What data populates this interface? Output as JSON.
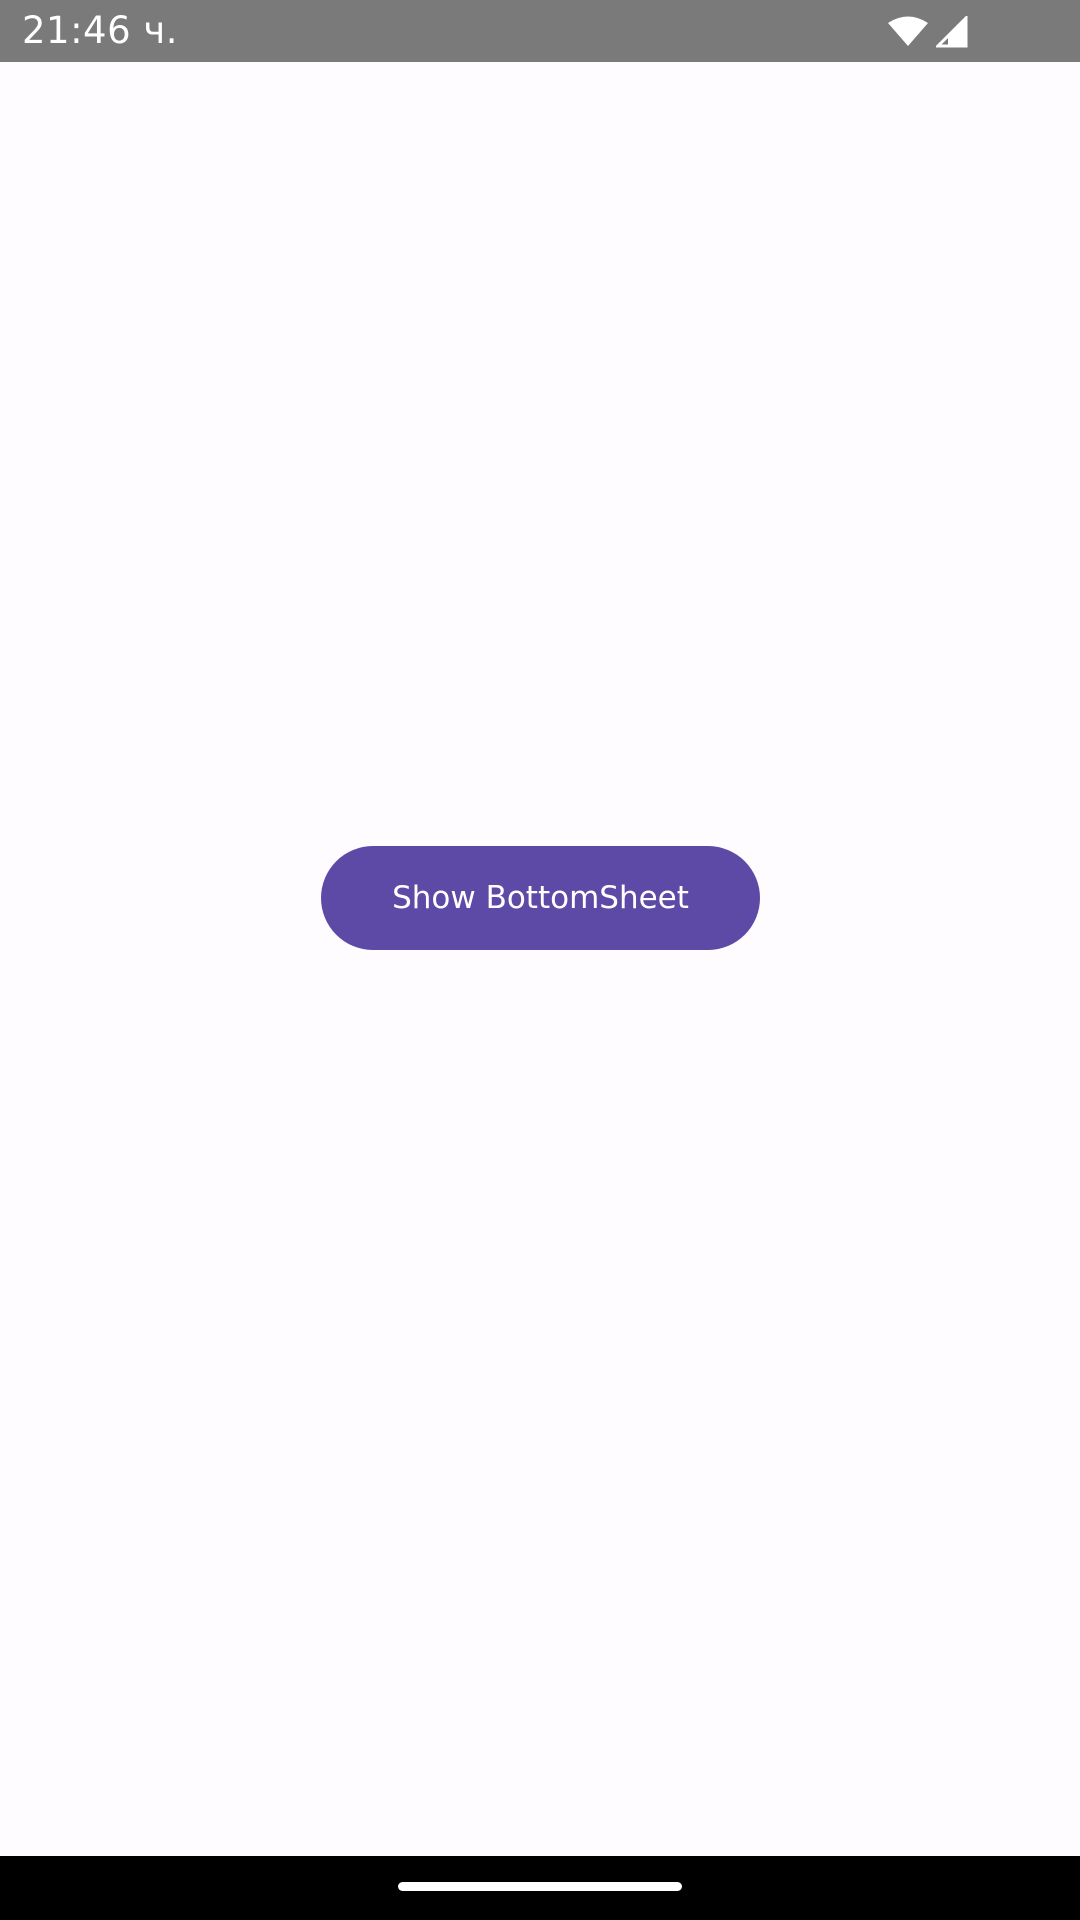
{
  "status_bar": {
    "time": "21:46 ч.",
    "icons": [
      "wifi-icon",
      "cellular-signal-icon"
    ]
  },
  "main": {
    "button_label": "Show BottomSheet",
    "button_color": "#5c4aa6"
  },
  "nav_bar": {
    "indicator_color": "#ffffff"
  }
}
